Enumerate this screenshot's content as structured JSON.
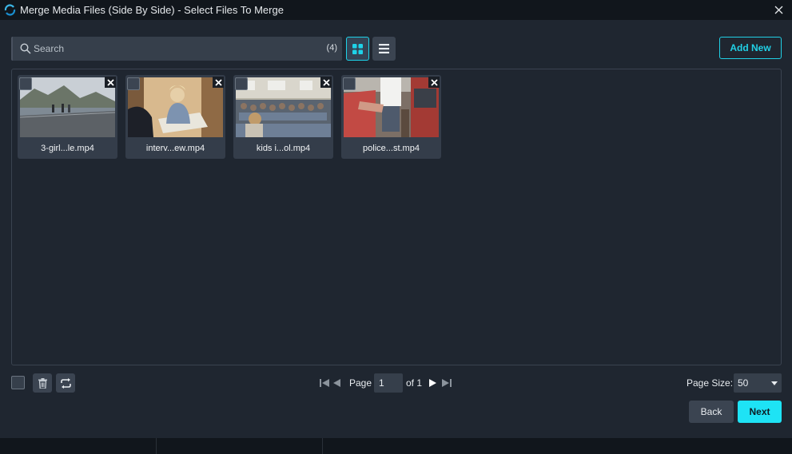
{
  "window": {
    "title": "Merge Media Files (Side By Side) - Select Files To Merge",
    "close_icon": "close-icon"
  },
  "toolbar": {
    "search_placeholder": "Search",
    "search_value": "",
    "count": "(4)",
    "view_mode": "grid",
    "add_new_label": "Add New"
  },
  "files": [
    {
      "name": "3-girl...le.mp4",
      "checked": false
    },
    {
      "name": "interv...ew.mp4",
      "checked": false
    },
    {
      "name": "kids i...ol.mp4",
      "checked": false
    },
    {
      "name": "police...st.mp4",
      "checked": false
    }
  ],
  "footer": {
    "page_label": "Page",
    "page_value": "1",
    "of_label": "of 1",
    "page_size_label": "Page Size:",
    "page_size_value": "50",
    "back_label": "Back",
    "next_label": "Next"
  },
  "colors": {
    "accent": "#1ee3f5",
    "background": "#1f2630",
    "titlebar": "#11161c"
  }
}
